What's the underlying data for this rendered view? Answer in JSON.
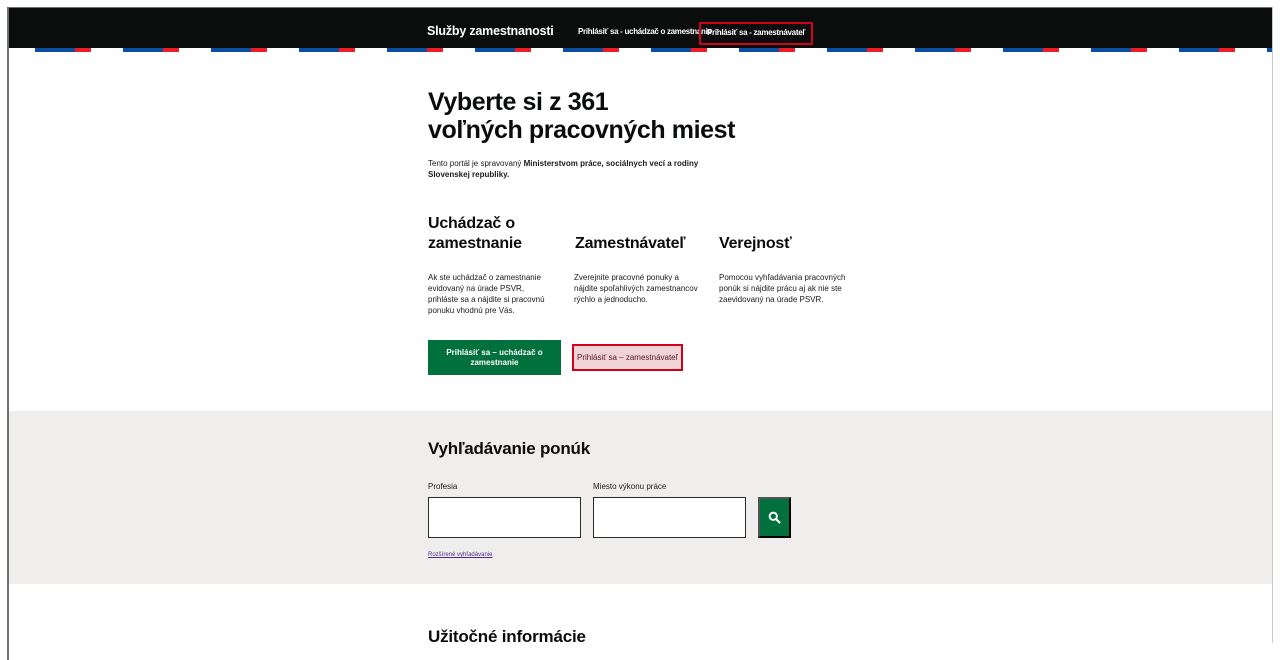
{
  "header": {
    "brand": "Služby zamestnanosti",
    "nav": {
      "jobseeker_login": "Prihlásiť sa - uchádzač o zamestnanie",
      "employer_login": "Prihlásiť sa - zamestnávateľ"
    }
  },
  "hero": {
    "title_line1": "Vyberte si z 361",
    "title_line2": "voľných pracovných miest",
    "intro_prefix": "Tento portál je spravovaný ",
    "intro_bold": "Ministerstvom práce, sociálnych vecí a rodiny Slovenskej republiky."
  },
  "columns": [
    {
      "title": "Uchádzač o zamestnanie",
      "text": "Ak ste uchádzač o zamestnanie evidovaný na úrade PSVR, prihláste sa a nájdite si pracovnú ponuku vhodnú pre Vás.",
      "button": "Prihlásiť sa – uchádzač o zamestnanie"
    },
    {
      "title": "Zamestnávateľ",
      "text": "Zverejnite pracovné ponuky a nájdite spoľahlivých zamestnancov rýchlo a jednoducho.",
      "button": "Prihlásiť sa – zamestnávateľ"
    },
    {
      "title": "Verejnosť",
      "text": "Pomocou vyhľadávania pracovných ponúk si nájdite prácu aj ak nie ste zaevidovaný na úrade PSVR."
    }
  ],
  "search": {
    "title": "Vyhľadávanie ponúk",
    "profession_label": "Profesia",
    "profession_value": "",
    "location_label": "Miesto výkonu práce",
    "location_value": "",
    "advanced_link": "Rozšírené vyhľadávanie",
    "button_icon": "search-icon"
  },
  "info": {
    "title": "Užitočné informácie"
  },
  "colors": {
    "header_bg": "#0b0c0c",
    "primary_green": "#00703c",
    "highlight_red": "#d0021b",
    "band_bg": "#efeeec"
  }
}
